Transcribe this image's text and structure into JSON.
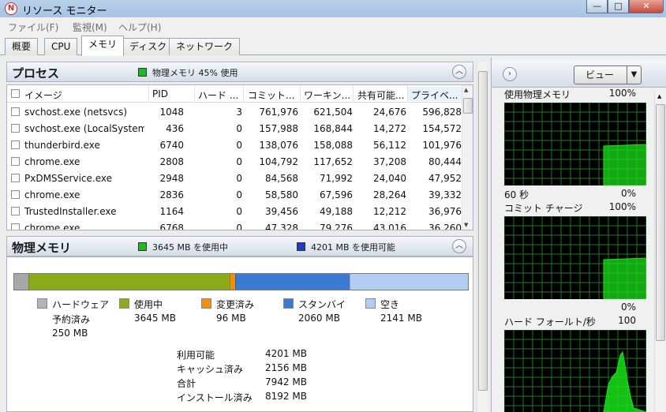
{
  "window": {
    "title": "リソース モニター",
    "minimize": "—",
    "maximize": "□",
    "close": "✕"
  },
  "menu": [
    "ファイル(F)",
    "監視(M)",
    "ヘルプ(H)"
  ],
  "tabs": [
    "概要",
    "CPU",
    "メモリ",
    "ディスク",
    "ネットワーク"
  ],
  "active_tab": 2,
  "process_panel": {
    "title": "プロセス",
    "indicator_color": "#1dbb1d",
    "indicator_text": "物理メモリ 45% 使用",
    "columns": [
      "イメージ",
      "PID",
      "ハード ...",
      "コミット...",
      "ワーキン...",
      "共有可能...",
      "プライベ..."
    ],
    "rows": [
      [
        "svchost.exe (netsvcs)",
        "1048",
        "3",
        "761,976",
        "621,504",
        "24,676",
        "596,828"
      ],
      [
        "svchost.exe (LocalSystem...",
        "436",
        "0",
        "157,988",
        "168,844",
        "14,272",
        "154,572"
      ],
      [
        "thunderbird.exe",
        "6740",
        "0",
        "138,076",
        "158,088",
        "56,112",
        "101,976"
      ],
      [
        "chrome.exe",
        "2808",
        "0",
        "104,792",
        "117,652",
        "37,208",
        "80,444"
      ],
      [
        "PxDMSService.exe",
        "2948",
        "0",
        "84,568",
        "71,992",
        "24,040",
        "47,952"
      ],
      [
        "chrome.exe",
        "2836",
        "0",
        "58,580",
        "67,596",
        "28,264",
        "39,332"
      ],
      [
        "TrustedInstaller.exe",
        "1164",
        "0",
        "39,456",
        "49,188",
        "12,212",
        "36,976"
      ],
      [
        "chrome.exe",
        "6768",
        "0",
        "47,328",
        "79,276",
        "43,016",
        "36,260"
      ]
    ]
  },
  "memory_panel": {
    "title": "物理メモリ",
    "in_use_color": "#1dbb1d",
    "in_use_text": "3645 MB を使用中",
    "available_color": "#1f3fbf",
    "available_text": "4201 MB を使用可能",
    "bar_segments_mb": {
      "reserved": 250,
      "in_use": 3645,
      "modified": 96,
      "standby": 2060,
      "free": 2141
    },
    "legend": [
      {
        "color": "#b4b4b4",
        "label": "ハードウェア",
        "sublabel": "予約済み",
        "value": "250 MB"
      },
      {
        "color": "#8aac1a",
        "label": "使用中",
        "value": "3645 MB"
      },
      {
        "color": "#f0900c",
        "label": "変更済み",
        "value": "96 MB"
      },
      {
        "color": "#3a7ad0",
        "label": "スタンバイ",
        "value": "2060 MB"
      },
      {
        "color": "#b2cdf2",
        "label": "空き",
        "value": "2141 MB"
      }
    ],
    "summary": [
      {
        "label": "利用可能",
        "value": "4201 MB"
      },
      {
        "label": "キャッシュ済み",
        "value": "2156 MB"
      },
      {
        "label": "合計",
        "value": "7942 MB"
      },
      {
        "label": "インストール済み",
        "value": "8192 MB"
      }
    ]
  },
  "right_pane": {
    "view_button": "ビュー",
    "graphs": [
      {
        "title": "使用物理メモリ",
        "max": "100%",
        "footer_left": "60 秒",
        "footer_right": "0%"
      },
      {
        "title": "コミット チャージ",
        "max": "100%",
        "footer_right": "0%"
      },
      {
        "title": "ハード フォールト/秒",
        "max": "100"
      }
    ],
    "graph_line_color": "#19e019",
    "graph_grid_color": "#1f7a1f"
  }
}
